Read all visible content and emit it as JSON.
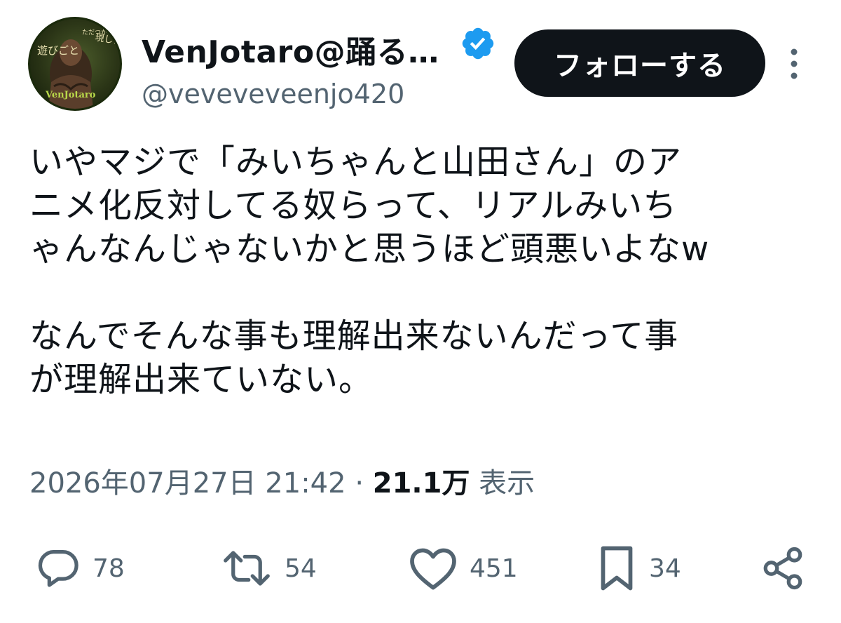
{
  "author": {
    "display_name": "VenJotaro@踊る…",
    "handle": "@veveveveenjo420",
    "verified": true,
    "avatar_icon": "avatar-image",
    "avatar_text": [
      "現し世は",
      "ただつかの間の",
      "遊びごと",
      "VenJotaro"
    ]
  },
  "follow_label": "フォローする",
  "body_text": "いやマジで「みいちゃんと山田さん」のア\nニメ化反対してる奴らって、リアルみいち\nゃんなんじゃないかと思うほど頭悪いよなw\n\nなんでそんな事も理解出来ないんだって事\nが理解出来ていない。",
  "meta": {
    "timestamp": "2026年07月27日 21:42",
    "separator": "·",
    "views_count": "21.1万",
    "views_label": "表示"
  },
  "actions": {
    "reply": {
      "icon": "reply-icon",
      "count": "78"
    },
    "retweet": {
      "icon": "retweet-icon",
      "count": "54"
    },
    "like": {
      "icon": "heart-icon",
      "count": "451"
    },
    "bookmark": {
      "icon": "bookmark-icon",
      "count": "34"
    },
    "share": {
      "icon": "share-icon"
    }
  },
  "colors": {
    "verified_blue": "#1d9bf0",
    "text_primary": "#0f1419",
    "text_secondary": "#536471"
  }
}
